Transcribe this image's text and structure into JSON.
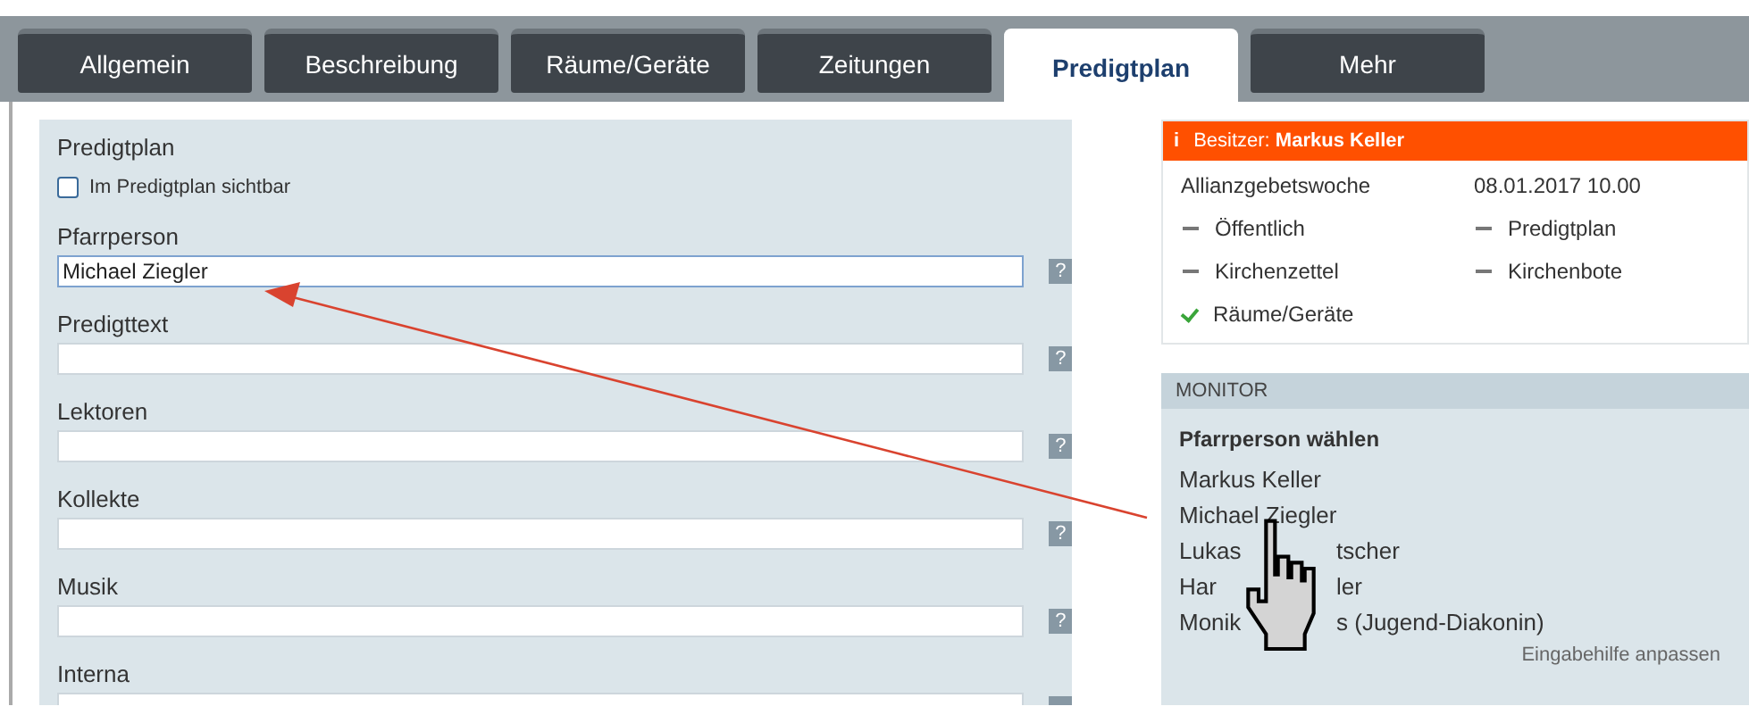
{
  "tabs": [
    {
      "label": "Allgemein",
      "selected": false
    },
    {
      "label": "Beschreibung",
      "selected": false
    },
    {
      "label": "Räume/Geräte",
      "selected": false
    },
    {
      "label": "Zeitungen",
      "selected": false
    },
    {
      "label": "Predigtplan",
      "selected": true
    },
    {
      "label": "Mehr",
      "selected": false
    }
  ],
  "form": {
    "title": "Predigtplan",
    "checkbox": {
      "label": "Im Predigtplan sichtbar",
      "checked": false
    },
    "fields": [
      {
        "label": "Pfarrperson",
        "value": "Michael Ziegler",
        "focused": true,
        "help": "?"
      },
      {
        "label": "Predigttext",
        "focused": false,
        "help": "?"
      },
      {
        "label": "Lektoren",
        "focused": false,
        "help": "?"
      },
      {
        "label": "Kollekte",
        "focused": false,
        "help": "?"
      },
      {
        "label": "Musik",
        "focused": false,
        "help": "?"
      },
      {
        "label": "Interna",
        "focused": false
      }
    ]
  },
  "info": {
    "icon": "i",
    "owner": "Besitzer: **Markus Keller**",
    "event": "Allianzgebetswoche",
    "date": "08.01.2017 10.00",
    "items": [
      {
        "label": "Öffentlich",
        "checked": false
      },
      {
        "label": "Predigtplan",
        "checked": false
      },
      {
        "label": "Kirchenzettel",
        "checked": false
      },
      {
        "label": "Kirchenbote",
        "checked": false
      },
      {
        "label": "Räume/Geräte",
        "checked": true
      }
    ]
  },
  "monitor": {
    "title": "MONITOR",
    "heading": "Pfarrperson wählen",
    "names": [
      {
        "parts": [
          "Markus Keller"
        ]
      },
      {
        "parts": [
          "Michael Ziegler"
        ]
      },
      {
        "parts": [
          "Lukas",
          "tscher"
        ]
      },
      {
        "parts": [
          "Har",
          "ler"
        ]
      },
      {
        "parts": [
          "Monik",
          "s (Jugend-Diakonin)"
        ]
      }
    ],
    "link": "Eingabehilfe anpassen"
  }
}
